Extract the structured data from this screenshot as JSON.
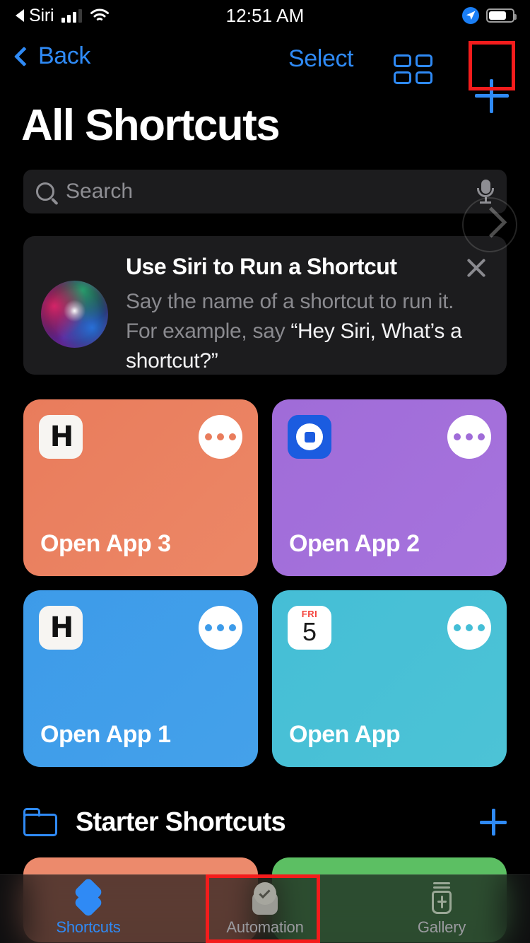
{
  "status_bar": {
    "back_label": "Siri",
    "time": "12:51 AM",
    "signal_bars_filled": 3,
    "signal_bars_total": 4,
    "wifi_icon": "wifi-icon",
    "location_icon": "location-arrow-icon",
    "battery_percent": 68
  },
  "nav_bar": {
    "back_label": "Back",
    "select_label": "Select",
    "grid_icon": "grid-view-icon",
    "add_icon": "plus-icon"
  },
  "page": {
    "title": "All Shortcuts"
  },
  "search": {
    "placeholder": "Search",
    "value": "",
    "search_icon": "search-icon",
    "mic_icon": "microphone-icon"
  },
  "overlay": {
    "next_icon": "chevron-right-circle-icon"
  },
  "siri_banner": {
    "orb_icon": "siri-orb-icon",
    "title": "Use Siri to Run a Shortcut",
    "body_plain": "Say the name of a shortcut to run it. For example, say ",
    "body_quote": "“Hey Siri, What’s a shortcut?”",
    "close_icon": "close-icon"
  },
  "shortcuts": [
    {
      "name": "Open App 3",
      "color": "#e97c5c",
      "color_end": "#ec8766",
      "icon": "hulu-app-icon",
      "icon_kind": "h",
      "menu_icon": "more-options-icon",
      "dot_color": "#e97c5c"
    },
    {
      "name": "Open App 2",
      "color": "#a06cd8",
      "color_end": "#a673dd",
      "icon": "bluesky-app-icon",
      "icon_kind": "square",
      "menu_icon": "more-options-icon",
      "dot_color": "#a06cd8"
    },
    {
      "name": "Open App 1",
      "color": "#3d9be9",
      "color_end": "#44a1ea",
      "icon": "hulu-app-icon",
      "icon_kind": "h",
      "menu_icon": "more-options-icon",
      "dot_color": "#3d9be9"
    },
    {
      "name": "Open App",
      "color": "#45bed6",
      "color_end": "#4cc3d6",
      "icon": "calendar-app-icon",
      "icon_kind": "calendar",
      "menu_icon": "more-options-icon",
      "dot_color": "#45bed6"
    }
  ],
  "calendar_icon": {
    "weekday": "FRI",
    "day": "5"
  },
  "app_glyph": {
    "h_letter": "H"
  },
  "section": {
    "folder_icon": "folder-icon",
    "title": "Starter Shortcuts",
    "add_icon": "plus-icon"
  },
  "peek_cards": [
    {
      "color": "#ec8a6c"
    },
    {
      "color": "#5cbf63"
    }
  ],
  "tab_bar": [
    {
      "label": "Shortcuts",
      "icon": "shortcuts-stack-icon",
      "active": true
    },
    {
      "label": "Automation",
      "icon": "automation-clock-icon",
      "active": false
    },
    {
      "label": "Gallery",
      "icon": "gallery-jar-icon",
      "active": false
    }
  ],
  "highlights": {
    "accent_color": "#f41c1c",
    "targets": [
      "add-shortcut-button",
      "tab-automation"
    ]
  },
  "colors": {
    "accent_blue": "#2f8af5",
    "background": "#000000",
    "card_bg": "#1c1c1e",
    "secondary_text": "#8a8a8f"
  }
}
